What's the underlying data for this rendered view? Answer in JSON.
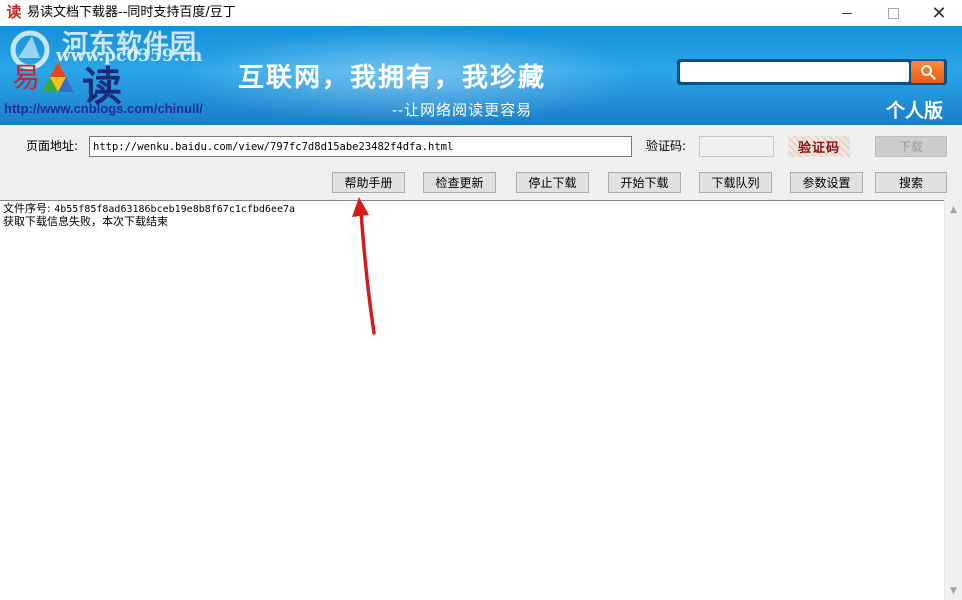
{
  "window": {
    "app_icon_glyph": "读",
    "title": "易读文档下载器--同时支持百度/豆丁"
  },
  "banner": {
    "watermark_title": "河东软件园",
    "watermark_site": "www.pc0359.cn",
    "logo_char": "读",
    "logo_swirl": "易",
    "blog_url": "http://www.cnblogs.com/chinull/",
    "slogan": "互联网，我拥有，我珍藏",
    "sub_slogan": "--让网络阅读更容易",
    "edition": "个人版",
    "search": {
      "value": ""
    }
  },
  "form": {
    "url_label": "页面地址:",
    "url_value": "http://wenku.baidu.com/view/797fc7d8d15abe23482f4dfa.html",
    "captcha_label": "验证码:",
    "captcha_value": "",
    "captcha_image_text": "验证码",
    "download_label": "下载"
  },
  "toolbar": {
    "help": "帮助手册",
    "check_update": "检查更新",
    "stop_download": "停止下载",
    "start_download": "开始下载",
    "download_queue": "下载队列",
    "settings": "参数设置",
    "search": "搜索"
  },
  "output": {
    "lines": [
      {
        "label": "文件序号:",
        "value": "4b55f85f8ad63186bceb19e8b8f67c1cfbd6ee7a"
      },
      {
        "label": "获取下载信息失败，本次下载结束",
        "value": ""
      }
    ]
  },
  "colors": {
    "banner_blue": "#1f98de",
    "annotation_arrow": "#e02020",
    "search_button": "#f07020"
  }
}
